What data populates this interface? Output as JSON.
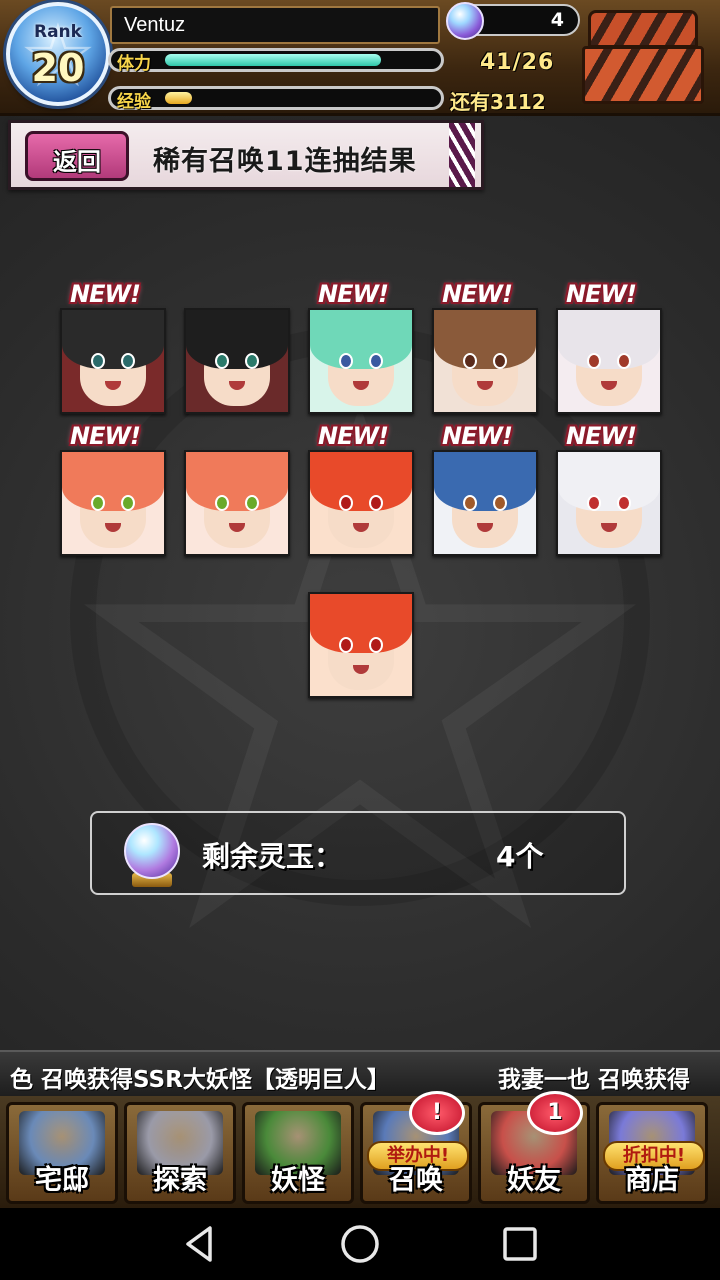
{
  "player": {
    "rank_label": "Rank",
    "rank": "20",
    "name": "Ventuz",
    "stamina_label": "体力",
    "exp_label": "经验",
    "stamina_value": "41/26",
    "remaining_time": "还有3112",
    "stamina_fill": 0.8,
    "exp_fill": 0.1,
    "orb_count": "4"
  },
  "header": {
    "back_label": "返回",
    "title": "稀有召唤11连抽结果"
  },
  "results": [
    {
      "new": true,
      "label": "NEW!",
      "hair": "#2a2a2a",
      "eye": "#2a6a6a",
      "bg": "#7a2a2a"
    },
    {
      "new": false,
      "label": "",
      "hair": "#1e1e1e",
      "eye": "#2a7a6a",
      "bg": "#6a2a2a"
    },
    {
      "new": true,
      "label": "NEW!",
      "hair": "#6fd8b8",
      "eye": "#3a5aa0",
      "bg": "#d8f4ea"
    },
    {
      "new": true,
      "label": "NEW!",
      "hair": "#8a5a3a",
      "eye": "#5a2a1a",
      "bg": "#f1e1d6"
    },
    {
      "new": true,
      "label": "NEW!",
      "hair": "#e8e4ea",
      "eye": "#a03a2a",
      "bg": "#f4ecf0"
    },
    {
      "new": true,
      "label": "NEW!",
      "hair": "#f07a5a",
      "eye": "#6aaa2a",
      "bg": "#fbe6dc"
    },
    {
      "new": false,
      "label": "",
      "hair": "#f07a5a",
      "eye": "#6aaa2a",
      "bg": "#fbe6dc"
    },
    {
      "new": true,
      "label": "NEW!",
      "hair": "#e84a2a",
      "eye": "#b01a1a",
      "bg": "#fbe0cc"
    },
    {
      "new": true,
      "label": "NEW!",
      "hair": "#3a6ab0",
      "eye": "#a05a2a",
      "bg": "#f0f2f6"
    },
    {
      "new": true,
      "label": "NEW!",
      "hair": "#f0f0f4",
      "eye": "#c03030",
      "bg": "#e8e8ee"
    },
    {
      "new": false,
      "label": "",
      "hair": "#e84a2a",
      "eye": "#b01a1a",
      "bg": "#fbe0cc"
    }
  ],
  "orbs_panel": {
    "label": "剩余灵玉：",
    "value": "4个"
  },
  "ticker": {
    "text": "色 召唤获得SSR大妖怪【透明巨人】",
    "text2": "我妻一也 召唤获得"
  },
  "menu": [
    {
      "label": "宅邸",
      "icon": "house-icon",
      "color": "#6a8ab8"
    },
    {
      "label": "探索",
      "icon": "magnifier-icon",
      "color": "#9a9aa8"
    },
    {
      "label": "妖怪",
      "icon": "scroll-icon",
      "color": "#4a8a3a"
    },
    {
      "label": "召唤",
      "icon": "pentagram-icon",
      "color": "#5a7ab8",
      "tag": "举办中!",
      "notif": "!"
    },
    {
      "label": "妖友",
      "icon": "friend-icon",
      "color": "#c8504a",
      "notif": "1"
    },
    {
      "label": "商店",
      "icon": "orb-shop-icon",
      "color": "#7a7ad8",
      "tag": "折扣中!"
    }
  ],
  "colors": {
    "accent": "#e66aaa",
    "gold": "#ffe98a",
    "stamina": "#2fc5a8",
    "new_badge": "#8a1a2a"
  }
}
